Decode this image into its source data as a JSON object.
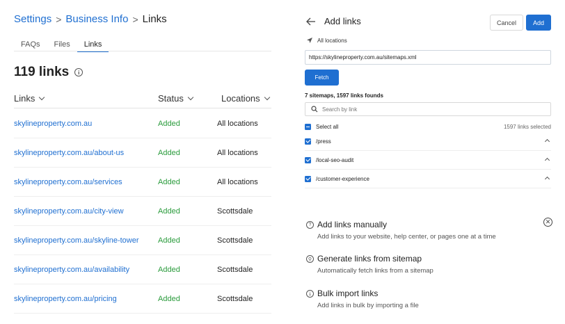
{
  "breadcrumb": {
    "settings": "Settings",
    "business_info": "Business Info",
    "current": "Links",
    "separator": ">"
  },
  "tabs": [
    {
      "label": "FAQs",
      "active": false
    },
    {
      "label": "Files",
      "active": false
    },
    {
      "label": "Links",
      "active": true
    }
  ],
  "links_count": "119 links",
  "info_icon": "i",
  "table": {
    "headers": {
      "links": "Links",
      "status": "Status",
      "locations": "Locations"
    },
    "rows": [
      {
        "link": "skylineproperty.com.au",
        "status": "Added",
        "location": "All locations"
      },
      {
        "link": "skylineproperty.com.au/about-us",
        "status": "Added",
        "location": "All locations"
      },
      {
        "link": "skylineproperty.com.au/services",
        "status": "Added",
        "location": "All locations"
      },
      {
        "link": "skylineproperty.com.au/city-view",
        "status": "Added",
        "location": "Scottsdale"
      },
      {
        "link": "skylineproperty.com.au/skyline-tower",
        "status": "Added",
        "location": "Scottsdale"
      },
      {
        "link": "skylineproperty.com.au/availability",
        "status": "Added",
        "location": "Scottsdale"
      },
      {
        "link": "skylineproperty.com.au/pricing",
        "status": "Added",
        "location": "Scottsdale"
      }
    ]
  },
  "panel": {
    "title": "Add links",
    "cancel_label": "Cancel",
    "add_label": "Add",
    "location": "All locations",
    "url_value": "https://skylineproperty.com.au/sitemaps.xml",
    "fetch_label": "Fetch",
    "summary": "7 sitemaps, 1597 links founds",
    "search_placeholder": "Search by link",
    "select_all_label": "Select all",
    "selected_count": "1597 links selected",
    "sitemaps": [
      {
        "path": "/press"
      },
      {
        "path": "/local-seo-audit"
      },
      {
        "path": "/customer-experience"
      }
    ],
    "options": [
      {
        "title": "Add links manually",
        "desc": "Add links to your website, help center, or pages one at a time",
        "icon": "question-icon",
        "glyph": "?"
      },
      {
        "title": "Generate links from sitemap",
        "desc": "Automatically fetch links from a sitemap",
        "icon": "link-icon",
        "glyph": "⚲"
      },
      {
        "title": "Bulk import links",
        "desc": "Add links in bulk by importing a file",
        "icon": "import-icon",
        "glyph": "⤓"
      }
    ],
    "close_glyph": "✕"
  },
  "colors": {
    "accent": "#1f6fd1",
    "status_added": "#2a9b3c"
  }
}
